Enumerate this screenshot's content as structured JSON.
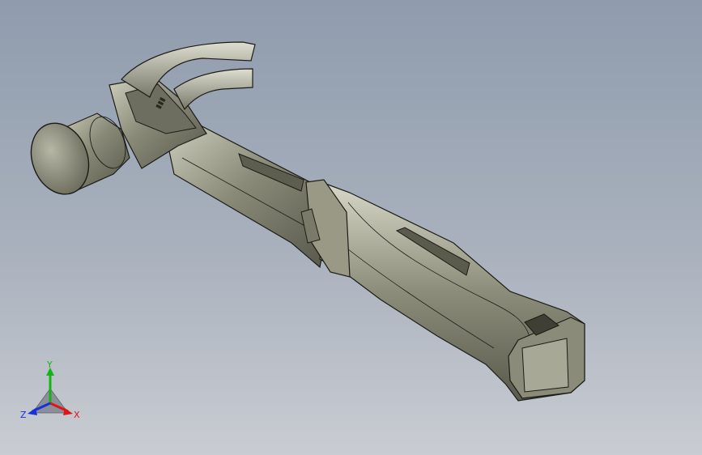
{
  "viewport": {
    "background_top": "#8f9cad",
    "background_bottom": "#c9ccd2",
    "model_icon": "claw-hammer-3d-model"
  },
  "model": {
    "body_color": "#7d7d6c",
    "highlight_color": "#c9c9b9",
    "shadow_color": "#4e4e42",
    "edge_color": "#1c1c17"
  },
  "triad": {
    "x_label": "X",
    "y_label": "Y",
    "z_label": "Z",
    "x_color": "#e01515",
    "y_color": "#16b316",
    "z_color": "#1a2fd8"
  }
}
